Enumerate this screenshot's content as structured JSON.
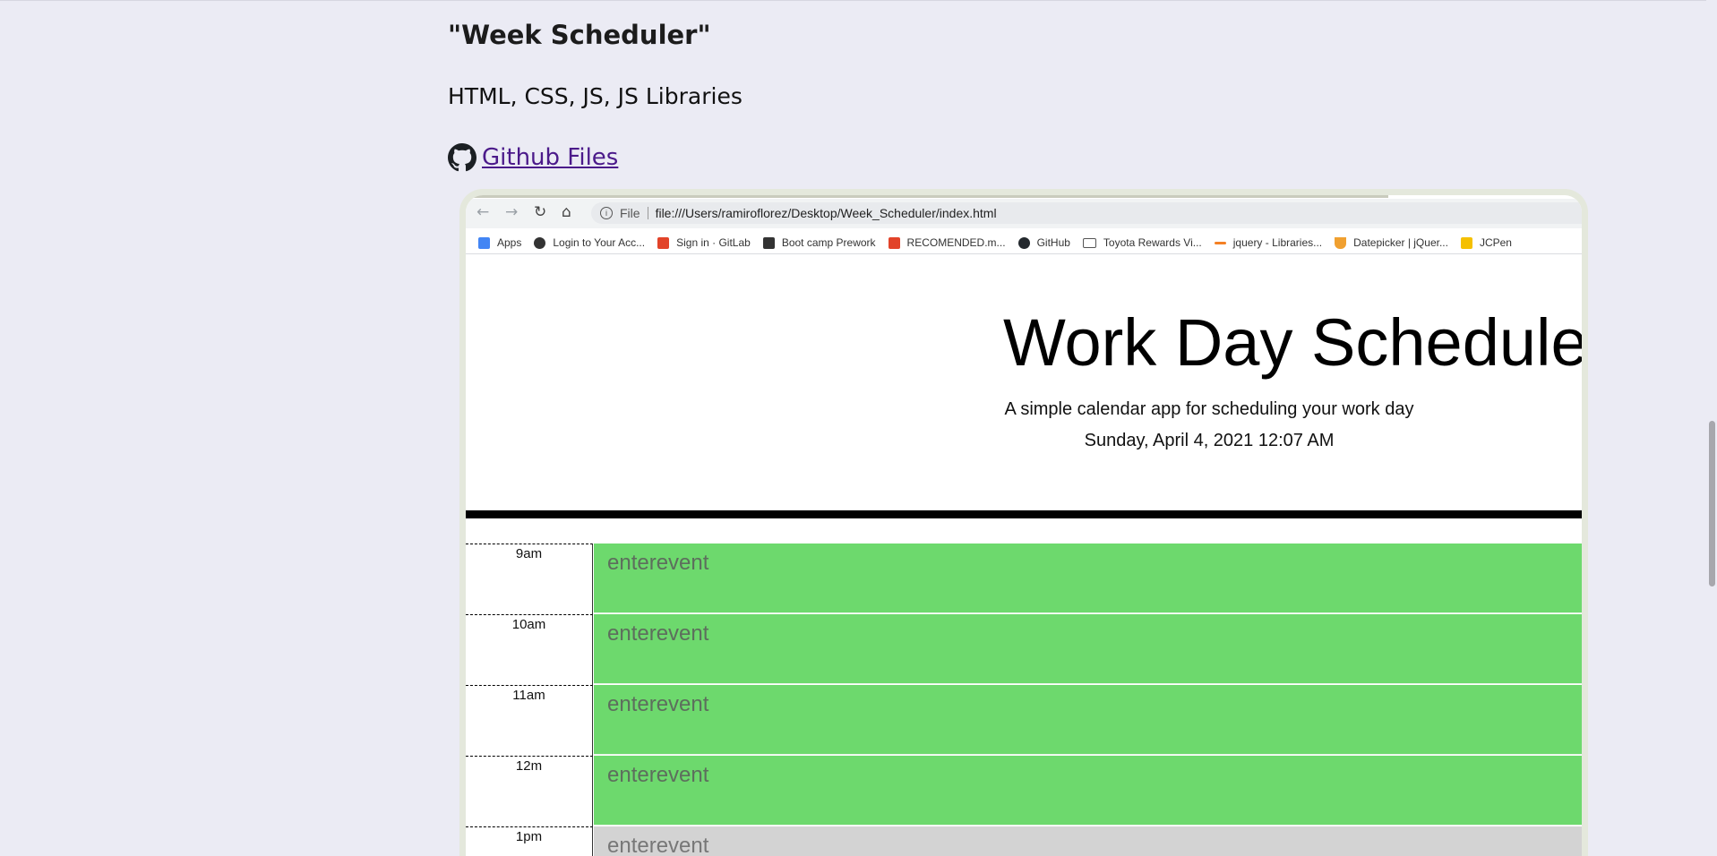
{
  "page": {
    "title": "\"Week Scheduler\"",
    "tech": "HTML, CSS, JS, JS Libraries",
    "github_link": "Github Files"
  },
  "browser": {
    "url_scheme": "File",
    "url": "file:///Users/ramiroflorez/Desktop/Week_Scheduler/index.html",
    "bookmarks": [
      {
        "label": "Apps",
        "color": "#4285f4"
      },
      {
        "label": "Login to Your Acc...",
        "color": "#333333"
      },
      {
        "label": "Sign in · GitLab",
        "color": "#e24329"
      },
      {
        "label": "Boot camp Prework",
        "color": "#333333"
      },
      {
        "label": "RECOMENDED.m...",
        "color": "#e24329"
      },
      {
        "label": "GitHub",
        "color": "#24292e"
      },
      {
        "label": "Toyota Rewards Vi...",
        "color": "#555555"
      },
      {
        "label": "jquery - Libraries...",
        "color": "#f48024"
      },
      {
        "label": "Datepicker | jQuer...",
        "color": "#f0a030"
      },
      {
        "label": "JCPen",
        "color": "#f5c000"
      }
    ]
  },
  "app": {
    "title": "Work Day Scheduler",
    "subtitle": "A simple calendar app for scheduling your work day",
    "datetime": "Sunday, April 4, 2021 12:07 AM",
    "rows": [
      {
        "hour": "9am",
        "placeholder": "enterevent"
      },
      {
        "hour": "10am",
        "placeholder": "enterevent"
      },
      {
        "hour": "11am",
        "placeholder": "enterevent"
      },
      {
        "hour": "12m",
        "placeholder": "enterevent"
      },
      {
        "hour": "1pm",
        "placeholder": "enterevent"
      }
    ]
  },
  "colors": {
    "background": "#ebebf4",
    "link": "#4b1a8a",
    "future_row": "#6dd96d",
    "past_row": "#d3d3d3"
  }
}
